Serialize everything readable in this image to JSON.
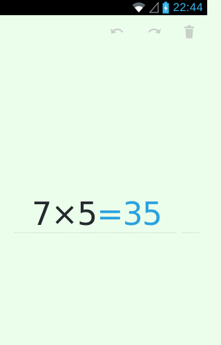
{
  "status_bar": {
    "time": "22:44",
    "icons": [
      "wifi-icon",
      "signal-icon",
      "battery-charging-icon"
    ]
  },
  "toolbar": {
    "actions": [
      "undo-icon",
      "redo-icon",
      "delete-icon"
    ]
  },
  "calculation": {
    "operand1": "7",
    "operator": "×",
    "operand2": "5",
    "equals": "=",
    "result": "35"
  },
  "colors": {
    "background": "#ebfdeb",
    "text": "#24292d",
    "accent": "#2aa2e0",
    "clock": "#39b4e8",
    "toolbar_icon": "#c9cfc9"
  }
}
